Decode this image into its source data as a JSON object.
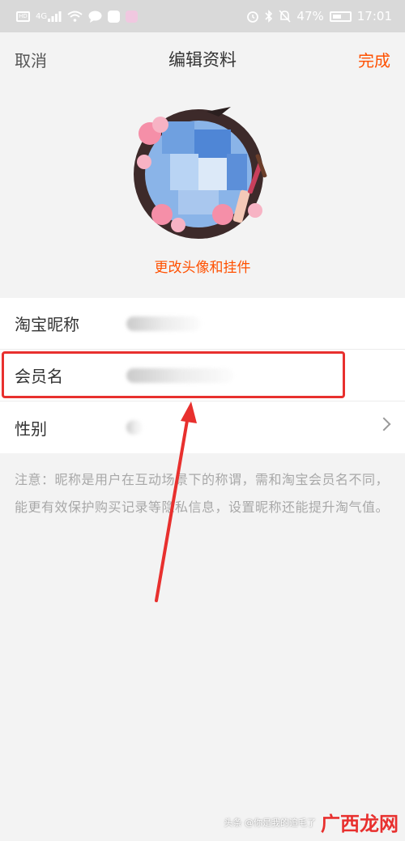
{
  "status_bar": {
    "carrier_badge": "HD",
    "network_badge": "4G",
    "battery_percent": "47%",
    "time": "17:01"
  },
  "nav": {
    "cancel_label": "取消",
    "title": "编辑资料",
    "done_label": "完成"
  },
  "avatar": {
    "change_label": "更改头像和挂件"
  },
  "profile": {
    "rows": [
      {
        "label": "淘宝昵称"
      },
      {
        "label": "会员名"
      },
      {
        "label": "性别"
      }
    ]
  },
  "note": "注意：昵称是用户在互动场景下的称谓，需和淘宝会员名不同，能更有效保护购买记录等隐私信息，设置昵称还能提升淘气值。",
  "watermark": {
    "source_label": "头条 @你是我的追毛了",
    "brand_label": "广西龙网"
  },
  "colors": {
    "accent": "#ff5000",
    "annotation_red": "#e8302e",
    "background": "#f3f3f3"
  }
}
